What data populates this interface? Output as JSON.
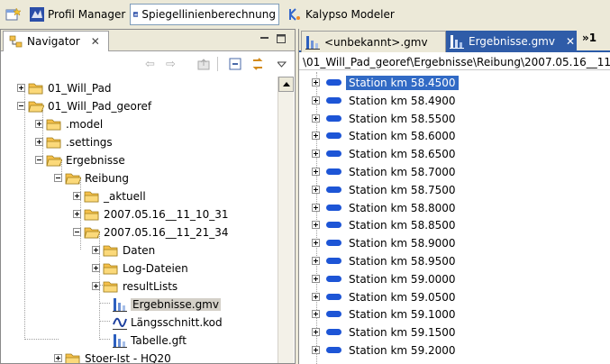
{
  "perspectives": [
    {
      "label": "Profil Manager",
      "icon": "profil-manager-icon"
    },
    {
      "label": "Spiegellinienberechnung",
      "icon": "spiegellinien-icon",
      "active": true
    },
    {
      "label": "Kalypso Modeler",
      "icon": "kalypso-modeler-icon"
    }
  ],
  "navigator": {
    "tab_label": "Navigator",
    "tree": [
      {
        "label": "01_Will_Pad",
        "expander": "plus"
      },
      {
        "label": "01_Will_Pad_georef",
        "expander": "minus"
      },
      {
        "label": ".model",
        "expander": "plus"
      },
      {
        "label": ".settings",
        "expander": "plus"
      },
      {
        "label": "Ergebnisse",
        "expander": "minus"
      },
      {
        "label": "Reibung",
        "expander": "minus"
      },
      {
        "label": "_aktuell",
        "expander": "plus"
      },
      {
        "label": "2007.05.16__11_10_31",
        "expander": "plus"
      },
      {
        "label": "2007.05.16__11_21_34",
        "expander": "minus"
      },
      {
        "label": "Daten",
        "expander": "plus"
      },
      {
        "label": "Log-Dateien",
        "expander": "plus"
      },
      {
        "label": "resultLists",
        "expander": "plus"
      },
      {
        "label": "Ergebnisse.gmv",
        "type": "gmv-file"
      },
      {
        "label": "Längsschnitt.kod",
        "type": "kod-file"
      },
      {
        "label": "Tabelle.gft",
        "type": "gft-file"
      },
      {
        "label": "Stoer-Ist - HQ20",
        "expander": "plus"
      }
    ]
  },
  "editor": {
    "tabs": [
      {
        "label": "<unbekannt>.gmv",
        "active": false
      },
      {
        "label": "Ergebnisse.gmv",
        "active": true
      }
    ],
    "more_tabs_label": "»1",
    "breadcrumb": "\\01_Will_Pad_georef\\Ergebnisse\\Reibung\\2007.05.16__11_2",
    "stations": [
      "Station km 58.4500",
      "Station km 58.4900",
      "Station km 58.5500",
      "Station km 58.6000",
      "Station km 58.6500",
      "Station km 58.7000",
      "Station km 58.7500",
      "Station km 58.8000",
      "Station km 58.8500",
      "Station km 58.9000",
      "Station km 58.9500",
      "Station km 59.0000",
      "Station km 59.0500",
      "Station km 59.1000",
      "Station km 59.1500",
      "Station km 59.2000"
    ],
    "selected_station": "Station km 58.4500"
  },
  "colors": {
    "selection": "#316ac5",
    "station_icon": "#1d55d6",
    "active_tab": "#2f5ca8",
    "folder": "#f5c04a"
  }
}
